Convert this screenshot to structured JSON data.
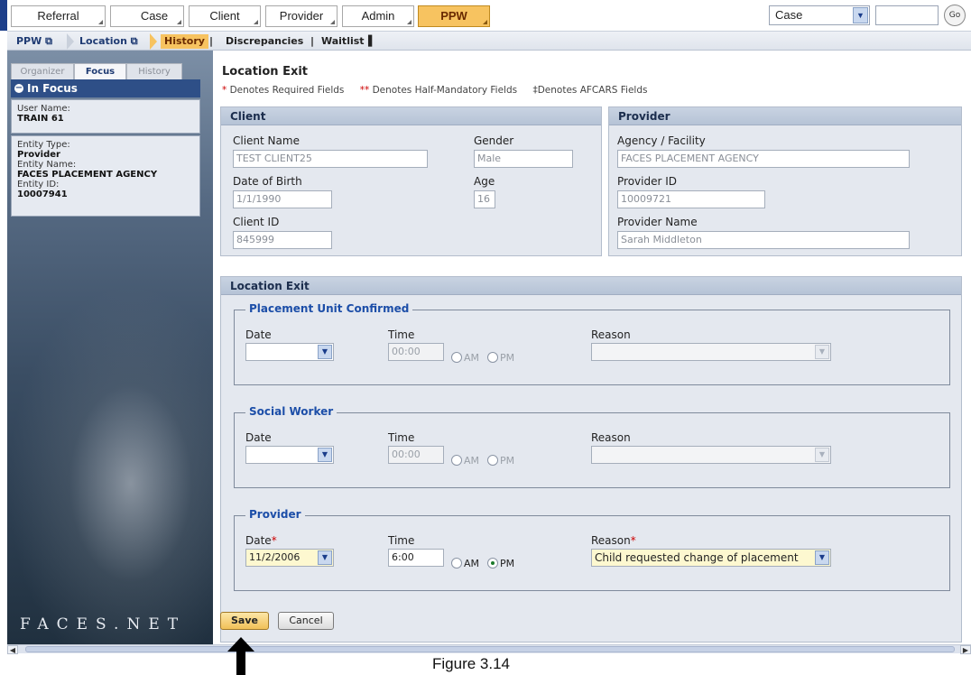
{
  "nav": {
    "tabs": [
      "Referral",
      "Case",
      "Client",
      "Provider",
      "Admin",
      "PPW"
    ],
    "active_tab": "PPW",
    "search_type": "Case",
    "search_value": "",
    "go_label": "Go"
  },
  "breadcrumb": {
    "items": [
      "PPW",
      "Location",
      "History",
      "Discrepancies",
      "Waitlist"
    ]
  },
  "sidebar": {
    "tabs": [
      "Organizer",
      "Focus",
      "History"
    ],
    "active_tab": "Focus",
    "section_title": "In Focus",
    "user_name_label": "User Name:",
    "user_name": "TRAIN 61",
    "entity_type_label": "Entity Type:",
    "entity_type": "Provider",
    "entity_name_label": "Entity Name:",
    "entity_name": "FACES PLACEMENT AGENCY",
    "entity_id_label": "Entity ID:",
    "entity_id": "10007941",
    "logo_text": "FACES.NET"
  },
  "page": {
    "title": "Location Exit",
    "legend_required": "Denotes Required Fields",
    "legend_half": "Denotes Half-Mandatory Fields",
    "legend_afcars": "Denotes AFCARS Fields",
    "star1": "*",
    "star2": "**",
    "dagger": "‡"
  },
  "client": {
    "header": "Client",
    "name_label": "Client Name",
    "name": "TEST CLIENT25",
    "gender_label": "Gender",
    "gender": "Male",
    "dob_label": "Date of Birth",
    "dob": "1/1/1990",
    "age_label": "Age",
    "age": "16",
    "id_label": "Client ID",
    "id": "845999"
  },
  "provider": {
    "header": "Provider",
    "agency_label": "Agency / Facility",
    "agency": "FACES PLACEMENT AGENCY",
    "id_label": "Provider ID",
    "id": "10009721",
    "name_label": "Provider Name",
    "name": "Sarah Middleton"
  },
  "exit": {
    "header": "Location Exit",
    "date_label": "Date",
    "time_label": "Time",
    "reason_label": "Reason",
    "am": "AM",
    "pm": "PM",
    "sections": [
      {
        "title": "Placement Unit Confirmed",
        "date": "",
        "time": "00:00",
        "reason": ""
      },
      {
        "title": "Social Worker",
        "date": "",
        "time": "00:00",
        "reason": ""
      },
      {
        "title": "Provider",
        "date": "11/2/2006",
        "time": "6:00",
        "reason": "Child requested change of placement",
        "meridiem": "PM"
      }
    ]
  },
  "buttons": {
    "save": "Save",
    "cancel": "Cancel"
  },
  "figure_caption": "Figure 3.14"
}
